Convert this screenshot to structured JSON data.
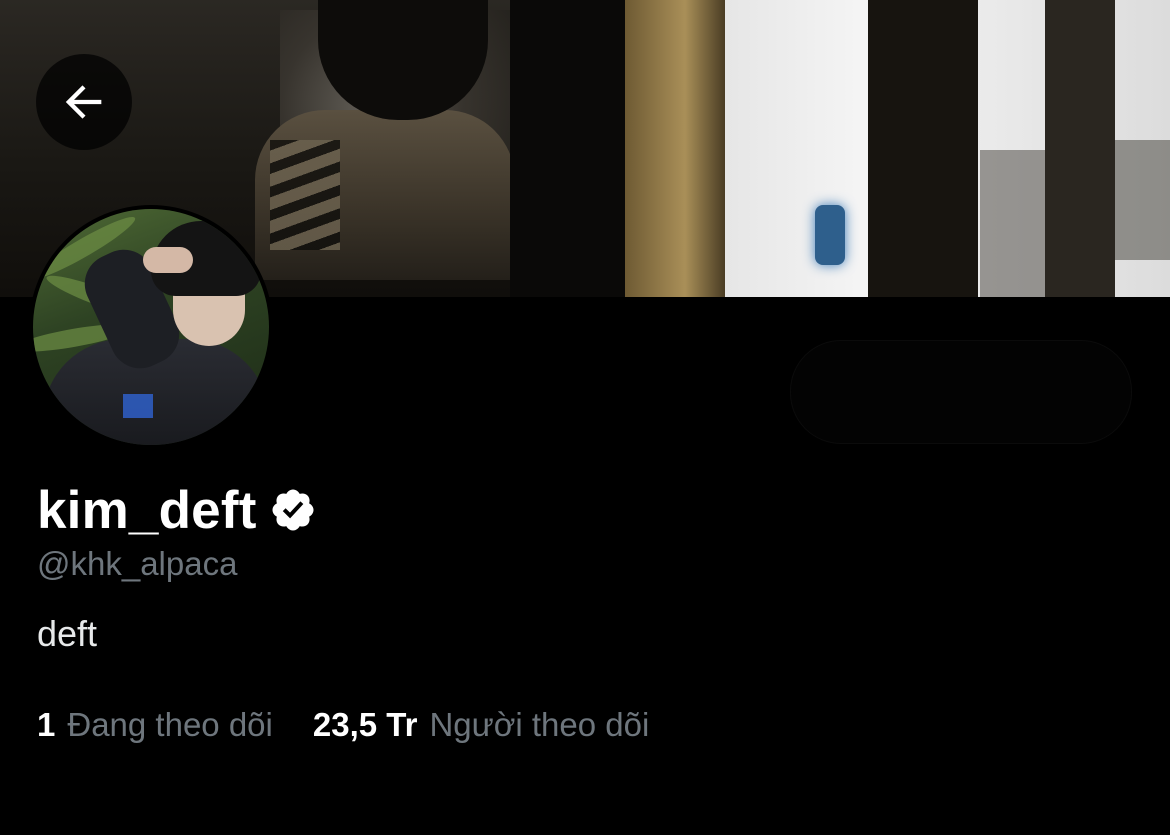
{
  "profile": {
    "display_name": "kim_deft",
    "handle": "@khk_alpaca",
    "bio": "deft",
    "verified": true
  },
  "stats": {
    "following_count": "1",
    "following_label": "Đang theo dõi",
    "followers_count": "23,5 Tr",
    "followers_label": "Người theo dõi"
  },
  "icons": {
    "back": "arrow-left-icon",
    "verified": "verified-badge-icon"
  },
  "colors": {
    "background": "#000000",
    "primary_text": "#ffffff",
    "secondary_text": "#6e767d"
  }
}
